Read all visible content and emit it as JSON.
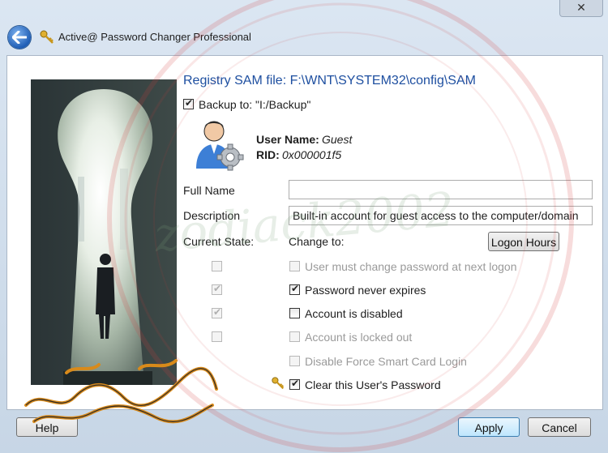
{
  "titlebar": {
    "close_label": "✕",
    "app_title": "Active@ Password Changer Professional"
  },
  "registry": {
    "sam_file": "Registry SAM file: F:\\WNT\\SYSTEM32\\config\\SAM",
    "backup_label": "Backup to: \"I:/Backup\"",
    "backup_checked": true
  },
  "user": {
    "name_label": "User Name:",
    "name_value": "Guest",
    "rid_label": "RID:",
    "rid_value": "0x000001f5",
    "avatar_icon": "user-gear-icon"
  },
  "form": {
    "full_name_label": "Full Name",
    "full_name_value": "",
    "description_label": "Description",
    "description_value": "Built-in account for guest access to the computer/domain",
    "current_state_label": "Current State:",
    "change_to_label": "Change to:",
    "logon_hours_label": "Logon Hours"
  },
  "options": [
    {
      "label": "User must change password at next logon",
      "current": false,
      "current_disabled": true,
      "checked": false,
      "disabled": true
    },
    {
      "label": "Password never expires",
      "current": true,
      "current_disabled": true,
      "checked": true,
      "disabled": false
    },
    {
      "label": "Account is disabled",
      "current": true,
      "current_disabled": true,
      "checked": false,
      "disabled": false
    },
    {
      "label": "Account is locked out",
      "current": false,
      "current_disabled": true,
      "checked": false,
      "disabled": true
    },
    {
      "label": "Disable Force Smart Card Login",
      "current": false,
      "current_disabled": true,
      "checked": false,
      "disabled": true
    },
    {
      "label": "Clear this User's Password",
      "current": null,
      "checked": true,
      "disabled": false,
      "has_key_icon": true
    }
  ],
  "footer": {
    "help_label": "Help",
    "apply_label": "Apply",
    "cancel_label": "Cancel"
  },
  "watermark_text": "zodiack2002",
  "colors": {
    "link_blue": "#1e4fa0",
    "primary_button": "#bee6fd",
    "window_bg": "#dbe6f2"
  }
}
